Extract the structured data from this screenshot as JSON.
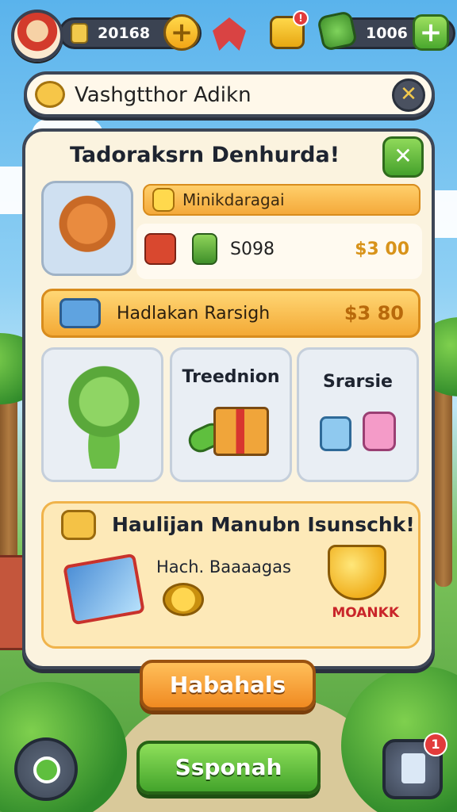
{
  "hud": {
    "coins": "20168",
    "coins_plus": "+",
    "gems": "1006",
    "gems_plus": "+",
    "chest_badge": "!"
  },
  "title_bar": {
    "title": "Vashgtthor Adikn",
    "close": "✕"
  },
  "panel": {
    "title": "Tadoraksrn Denhurda!",
    "close": "✕",
    "hero_banner": "Minikdaragai",
    "stat_value": "S098",
    "stat_value_2": "$3 00",
    "reward_label": "Hadlakan Rarsigh",
    "reward_value": "$3 80",
    "cards": [
      {
        "title": ""
      },
      {
        "title": "Treednion"
      },
      {
        "title": "Srarsie"
      }
    ],
    "quest": {
      "title": "Haulijan Manubn Isunschk!",
      "subtitle": "Hach. Baaaagas",
      "pot_label": "MOANKK"
    }
  },
  "buttons": {
    "orange": "Habahals",
    "green": "Ssponah",
    "mail_badge": "1"
  }
}
